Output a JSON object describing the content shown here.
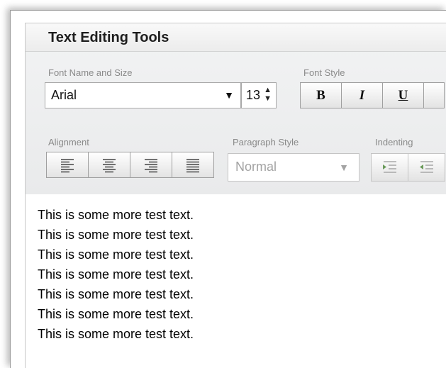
{
  "toolbar": {
    "title": "Text Editing Tools",
    "font": {
      "label": "Font Name and Size",
      "name": "Arial",
      "size": "13"
    },
    "font_style": {
      "label": "Font Style",
      "bold": "B",
      "italic": "I",
      "underline": "U"
    },
    "alignment": {
      "label": "Alignment",
      "buttons": [
        "align-left-icon",
        "align-center-icon",
        "align-right-icon",
        "align-justify-icon"
      ]
    },
    "paragraph_style": {
      "label": "Paragraph Style",
      "value": "Normal"
    },
    "indenting": {
      "label": "Indenting",
      "buttons": [
        "indent-increase-icon",
        "indent-decrease-icon"
      ]
    }
  },
  "editor": {
    "lines": [
      "This is some more test text.",
      "This is some more test text.",
      "This is some more test text.",
      "This is some more test text.",
      "This is some more test text.",
      "This is some more test text.",
      "This is some more test text."
    ]
  },
  "colors": {
    "toolbar_bg": "#eaebec",
    "border": "#a8a8a8",
    "label": "#8a8a8a",
    "disabled_text": "#a3a3a3"
  }
}
